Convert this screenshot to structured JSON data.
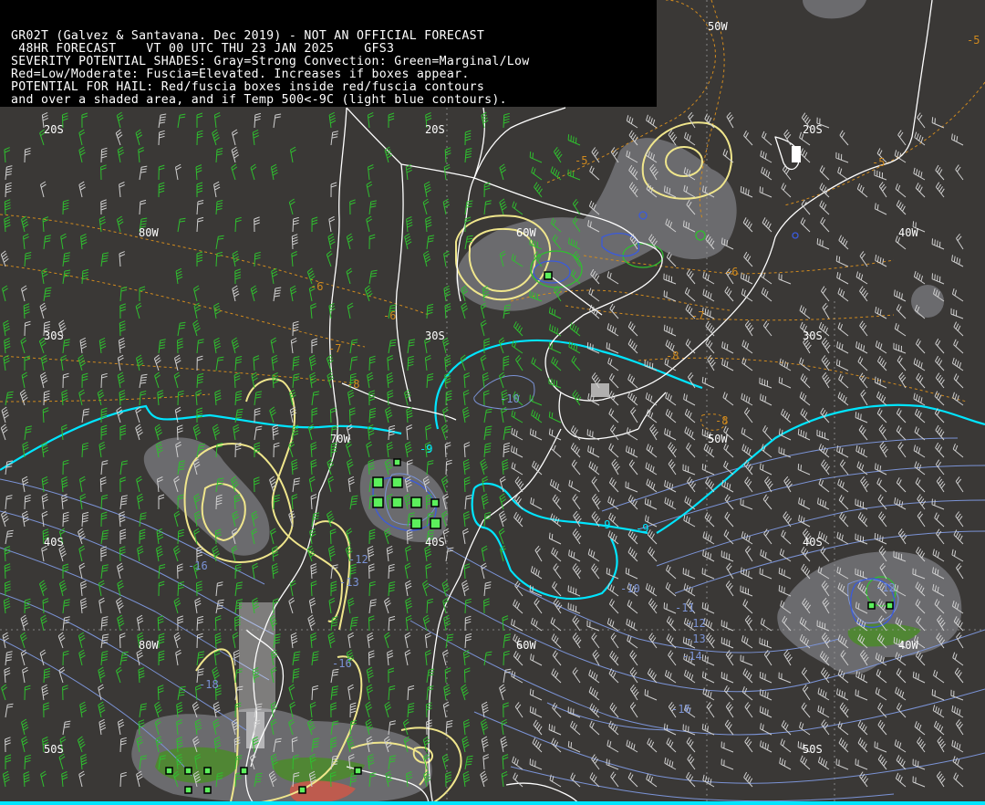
{
  "header": {
    "lines": [
      "GR02T (Galvez & Santavana. Dec 2019) - NOT AN OFFICIAL FORECAST",
      " 48HR FORECAST    VT 00 UTC THU 23 JAN 2025    GFS3",
      "SEVERITY POTENTIAL SHADES: Gray=Strong Convection: Green=Marginal/Low",
      "Red=Low/Moderate: Fuscia=Elevated. Increases if boxes appear.",
      "POTENTIAL FOR HAIL: Red/fuscia boxes inside red/fuscia contours",
      "and over a shaded area, and if Temp 500<-9C (light blue contours)."
    ]
  },
  "colors": {
    "background": "#3a3836",
    "header_bg": "#000000",
    "coast": "#ffffff",
    "gray_shade": "#6e6e72",
    "green_shade": "#4e8a2e",
    "red_shade": "#c85a4a",
    "yellow_contour": "#f0e68c",
    "cyan_contour": "#00e5ff",
    "isotherm_blue": "#7b93d6",
    "dashed_orange": "#d08a1e",
    "wind_barb": "#2fbf2f",
    "wind_barb_light": "#d0d0d0",
    "box_fill": "#5cf05c"
  },
  "map": {
    "grid_labels": [
      "20S",
      "20S",
      "20S",
      "50W",
      "80W",
      "60W",
      "40W",
      "30S",
      "30S",
      "30S",
      "70W",
      "50W",
      "40S",
      "40S",
      "40S",
      "80W",
      "60W",
      "40W",
      "50S",
      "50S"
    ],
    "orange_labels": [
      "-5",
      "-5",
      "-5",
      "-6",
      "-6",
      "-6",
      "-7",
      "-7",
      "-8",
      "-8",
      "-8",
      "-9"
    ],
    "cyan_labels": [
      "-9",
      "-9",
      "-9"
    ],
    "blue_labels": [
      "-10",
      "-10",
      "-11",
      "-12",
      "-13",
      "-14",
      "-16",
      "-16",
      "-16",
      "-18",
      "-12",
      "-13",
      "-12"
    ]
  }
}
